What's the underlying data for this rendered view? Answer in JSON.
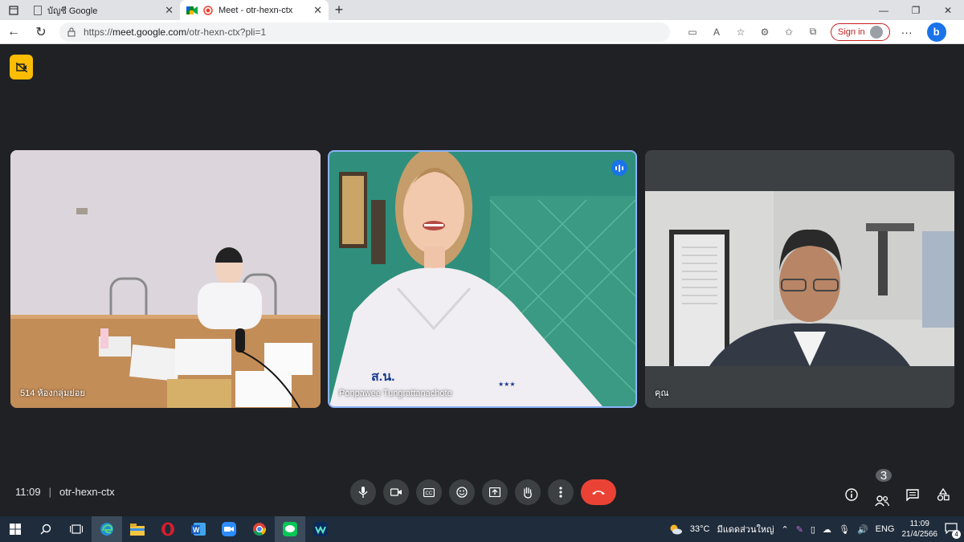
{
  "browser": {
    "tabs": [
      {
        "title": "บัญชี Google",
        "active": false
      },
      {
        "title": "Meet - otr-hexn-ctx",
        "active": true
      }
    ],
    "url_prefix": "https://",
    "url_domain": "meet.google.com",
    "url_path": "/otr-hexn-ctx?pli=1",
    "signin_label": "Sign in"
  },
  "meet": {
    "participants": [
      {
        "name": "514 ห้องกลุ่มย่อย",
        "speaking": false
      },
      {
        "name": "Ponpawee Tungrattanachote",
        "speaking": true
      },
      {
        "name": "คุณ",
        "speaking": false
      }
    ],
    "time": "11:09",
    "meeting_code": "otr-hexn-ctx",
    "people_count": "3",
    "controls": [
      "microphone",
      "camera",
      "captions",
      "reactions",
      "present",
      "raise-hand",
      "more-options",
      "leave-call"
    ]
  },
  "taskbar": {
    "weather": "33°C",
    "weather_desc": "มีแดดส่วนใหญ่",
    "lang": "ENG",
    "clock_time": "11:09",
    "clock_date": "21/4/2566",
    "notif_count": "4"
  },
  "colors": {
    "meet_bg": "#202124",
    "tile_bg": "#3c4043",
    "end_call": "#ea4335",
    "speaking_border": "#8ab4f8",
    "record_badge": "#fbbc04"
  }
}
